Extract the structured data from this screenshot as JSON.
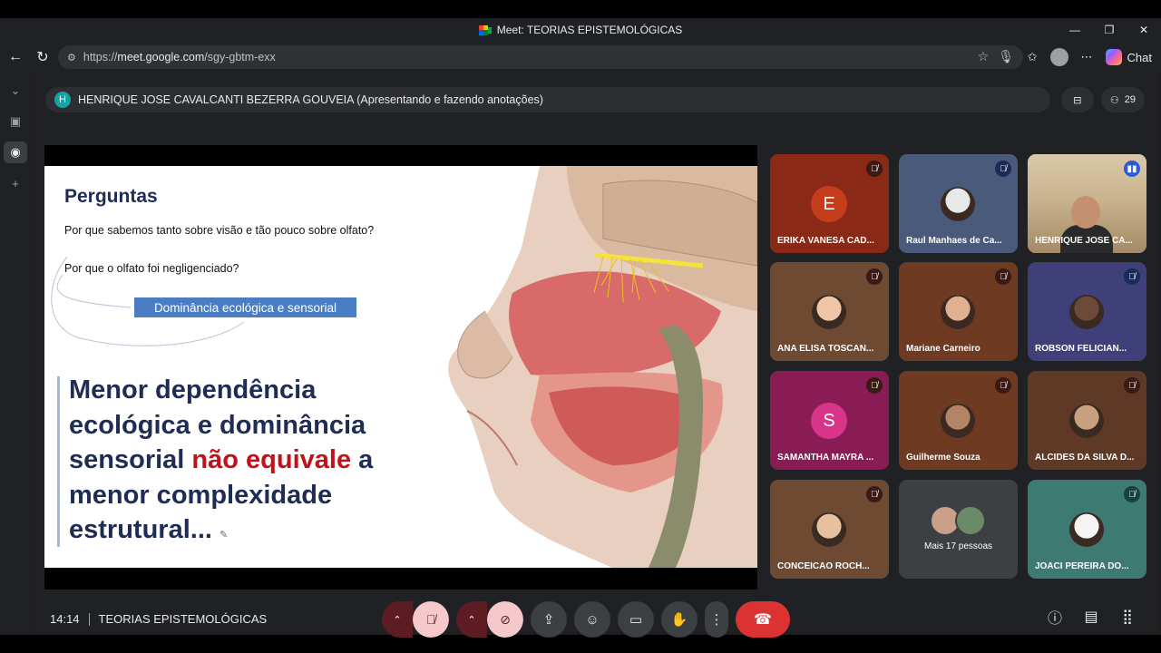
{
  "window": {
    "title": "Meet: TEORIAS EPISTEMOLÓGICAS"
  },
  "browser": {
    "url_prefix": "https://",
    "url_host": "meet.google.com",
    "url_path": "/sgy-gbtm-exx",
    "copilot_label": "Chat"
  },
  "meet": {
    "presenter_initial": "H",
    "presenter_text": "HENRIQUE JOSE CAVALCANTI BEZERRA GOUVEIA (Apresentando e fazendo anotações)",
    "participants_count": "29",
    "time": "14:14",
    "meeting_name": "TEORIAS EPISTEMOLÓGICAS"
  },
  "slide": {
    "title": "Perguntas",
    "question_1": "Por que sabemos tanto sobre visão e tão pouco sobre olfato?",
    "question_2": "Por que o olfato foi negligenciado?",
    "tag": "Dominância ecológica e sensorial",
    "statement_part1": "Menor dependência ecológica e dominância sensorial ",
    "statement_red": "não equivale",
    "statement_part2": " a menor complexidade estrutural..."
  },
  "tiles": [
    {
      "name": "ERIKA VANESA CAD...",
      "letter": "E",
      "bg": "#8a2a16",
      "avatar": "#c63d1b",
      "mic": "muted"
    },
    {
      "name": "Raul Manhaes de Ca...",
      "bg": "#4a5a7a",
      "mic": "muted-blue"
    },
    {
      "name": "HENRIQUE JOSE CA...",
      "bg": "#c8b896",
      "mic": "speaking"
    },
    {
      "name": "ANA ELISA TOSCAN...",
      "bg": "#6e4a33",
      "mic": "muted"
    },
    {
      "name": "Mariane Carneiro",
      "bg": "#6e3a22",
      "mic": "muted"
    },
    {
      "name": "ROBSON FELICIAN...",
      "bg": "#3f3f7a",
      "mic": "muted-blue"
    },
    {
      "name": "SAMANTHA MAYRA ...",
      "letter": "S",
      "bg": "#8a1c55",
      "avatar": "#d8358a",
      "mic": "muted"
    },
    {
      "name": "Guilherme Souza",
      "bg": "#6e3a22",
      "mic": "muted"
    },
    {
      "name": "ALCIDES DA SILVA D...",
      "bg": "#5e3a26",
      "mic": "muted"
    },
    {
      "name": "CONCEICAO ROCH...",
      "bg": "#6e4a33",
      "mic": "muted"
    },
    {
      "name": "Mais 17 pessoas",
      "bg": "#3c4043",
      "mic": "none"
    },
    {
      "name": "JOACI PEREIRA DO...",
      "bg": "#3c7a72",
      "mic": "muted-teal"
    }
  ]
}
